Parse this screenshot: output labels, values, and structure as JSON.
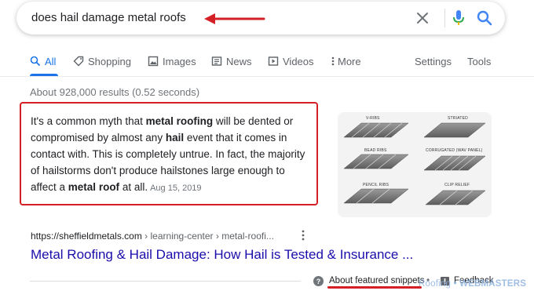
{
  "search": {
    "query": "does hail damage metal roofs"
  },
  "tabs": [
    {
      "label": "All",
      "icon": "search-icon",
      "active": true
    },
    {
      "label": "Shopping",
      "icon": "tag-icon"
    },
    {
      "label": "Images",
      "icon": "image-icon"
    },
    {
      "label": "News",
      "icon": "news-icon"
    },
    {
      "label": "Videos",
      "icon": "play-icon"
    },
    {
      "label": "More",
      "icon": "more-vert-icon"
    }
  ],
  "tools": {
    "settings": "Settings",
    "tools": "Tools"
  },
  "stats": "About 928,000 results (0.52 seconds)",
  "snippet": {
    "t1": "It's a common myth that ",
    "b1": "metal roofing",
    "t2": " will be dented or compromised by almost any ",
    "b2": "hail",
    "t3": " event that it comes in contact with. This is completely untrue. In fact, the majority of hailstorms don't produce hailstones large enough to affect a ",
    "b3": "metal roof",
    "t4": " at all.",
    "date": "Aug 15, 2019"
  },
  "image_labels": {
    "v_ribs": "V-RIBS",
    "striated": "STRIATED",
    "bead_ribs": "BEAD RIBS",
    "corrugated": "CORRUGATED (WAV PANEL)",
    "pencil_ribs": "PENCIL RIBS",
    "clip_relief": "CLIP RELIEF"
  },
  "result": {
    "url": "https://sheffieldmetals.com",
    "breadcrumb": " › learning-center › metal-roofi...",
    "title": "Metal Roofing & Hail Damage: How Hail is Tested & Insurance ..."
  },
  "footer": {
    "about": "About featured snippets",
    "separator": "•",
    "feedback": "Feedback"
  },
  "watermark": {
    "part1": "Roofing",
    "part2": " • WEBMASTERS"
  },
  "colors": {
    "annotation_red": "#d51f26",
    "link_blue": "#1a0dab",
    "active_tab_blue": "#1a73e8"
  }
}
